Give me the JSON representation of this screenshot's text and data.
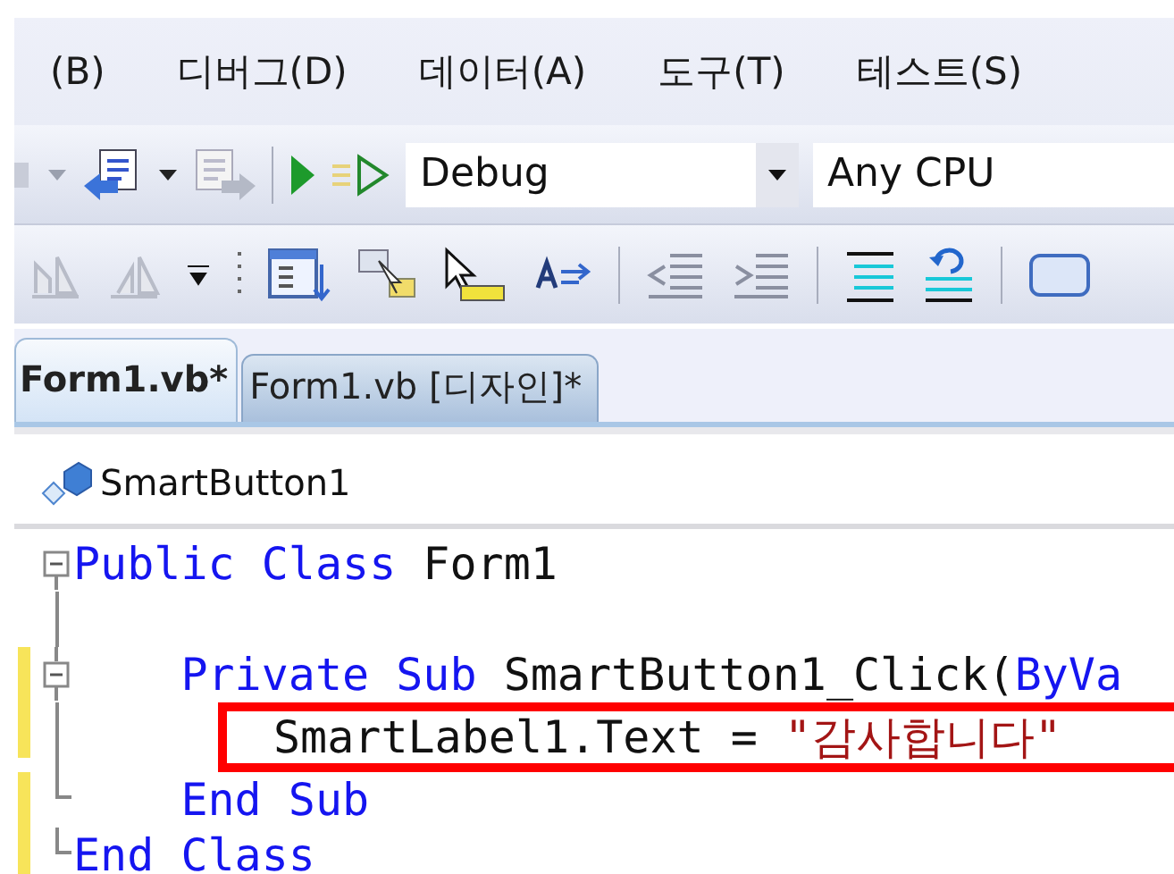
{
  "menu": [
    {
      "label": "(B)"
    },
    {
      "label": "디버그(D)"
    },
    {
      "label": "데이터(A)"
    },
    {
      "label": "도구(T)"
    },
    {
      "label": "테스트(S)"
    }
  ],
  "toolbar": {
    "configuration": "Debug",
    "platform": "Any CPU"
  },
  "tabs": [
    {
      "label": "Form1.vb*",
      "selected": true
    },
    {
      "label": "Form1.vb [디자인]*",
      "selected": false
    }
  ],
  "navigation": {
    "member": "SmartButton1"
  },
  "code": {
    "lines": [
      {
        "kind": "start",
        "changed": false,
        "highlighted": false,
        "tokens": [
          {
            "kind": "keyword",
            "text": "Public Class"
          },
          {
            "kind": "plain",
            "text": " Form1"
          }
        ]
      },
      {
        "kind": "middle",
        "changed": false,
        "highlighted": false
      },
      {
        "kind": "start",
        "changed": true,
        "highlighted": false,
        "tokens": [
          {
            "kind": "keyword",
            "text": "    Private Sub"
          },
          {
            "kind": "plain",
            "text": " SmartButton1_Click("
          },
          {
            "kind": "keyword",
            "text": "ByVa"
          }
        ]
      },
      {
        "kind": "middle",
        "changed": true,
        "highlighted": true,
        "tokens": [
          {
            "kind": "plain",
            "text": "SmartLabel1.Text = "
          },
          {
            "kind": "string",
            "text": "\"감사합니다\""
          }
        ]
      },
      {
        "kind": "end",
        "changed": true,
        "highlighted": false,
        "tokens": [
          {
            "kind": "keyword",
            "text": "    End Sub"
          }
        ]
      },
      {
        "kind": "end",
        "changed": true,
        "highlighted": false,
        "tokens": [
          {
            "kind": "keyword",
            "text": "End Class"
          }
        ]
      }
    ]
  }
}
